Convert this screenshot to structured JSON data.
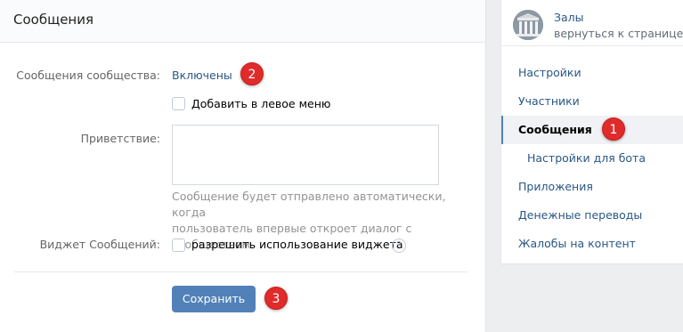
{
  "main": {
    "title": "Сообщения",
    "messages_label": "Сообщения сообщества:",
    "messages_value": "Включены",
    "add_left_menu_label": "Добавить в левое меню",
    "greeting_label": "Приветствие:",
    "greeting_value": "",
    "greeting_hint_line1": "Сообщение будет отправлено автоматически, когда",
    "greeting_hint_line2": "пользователь впервые откроет диалог с сообществом.",
    "widget_label": "Виджет Сообщений:",
    "widget_checkbox_label": "разрешить использование виджета",
    "help_icon": "?",
    "save_label": "Сохранить"
  },
  "badges": {
    "one": "1",
    "two": "2",
    "three": "3"
  },
  "sidebar": {
    "group_name": "Залы",
    "back_link": "вернуться к странице",
    "items": [
      {
        "label": "Настройки"
      },
      {
        "label": "Участники"
      },
      {
        "label": "Сообщения"
      },
      {
        "label": "Настройки для бота"
      },
      {
        "label": "Приложения"
      },
      {
        "label": "Денежные переводы"
      },
      {
        "label": "Жалобы на контент"
      }
    ]
  },
  "colors": {
    "accent": "#5181b8",
    "link": "#2a5885",
    "badge": "#e02b2b",
    "background": "#edeef0"
  }
}
